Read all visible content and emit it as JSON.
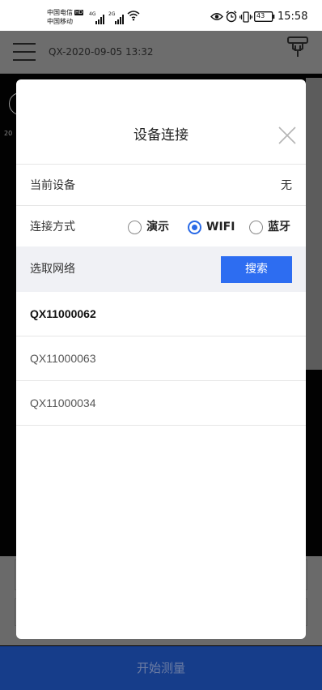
{
  "status_bar": {
    "carrier_1": "中国电信",
    "carrier_1_badge": "HD",
    "carrier_2": "中国移动",
    "signal_1_type": "4G",
    "signal_2_type": "2G",
    "battery": "43",
    "time": "15:58"
  },
  "app_bar": {
    "title": "QX-2020-09-05 13:32",
    "menu_icon": "hamburger-icon",
    "device_icon": "measuring-device-icon"
  },
  "background": {
    "small_text": "20"
  },
  "dialog": {
    "title": "设备连接",
    "close_icon": "close-icon",
    "current_device_label": "当前设备",
    "current_device_value": "无",
    "connection_method_label": "连接方式",
    "connection_options": [
      {
        "label": "演示",
        "selected": false
      },
      {
        "label": "WIFI",
        "selected": true
      },
      {
        "label": "蓝牙",
        "selected": false
      }
    ],
    "network_section_label": "选取网络",
    "search_button": "搜索",
    "networks": [
      {
        "name": "QX11000062",
        "selected": true
      },
      {
        "name": "QX11000063",
        "selected": false
      },
      {
        "name": "QX11000034",
        "selected": false
      }
    ]
  },
  "bottom": {
    "start_button": "开始测量"
  },
  "colors": {
    "accent": "#2d6df1",
    "start_button_dimmed": "#163d8a",
    "overlay_gray": "#6d6d6d"
  }
}
